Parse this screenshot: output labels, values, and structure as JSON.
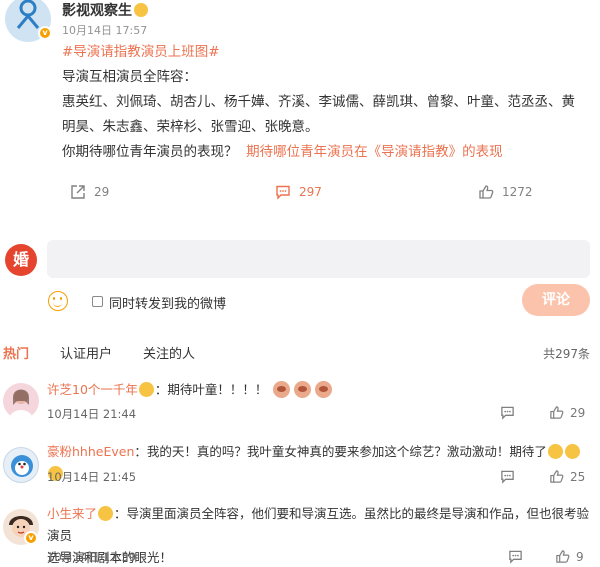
{
  "post": {
    "author": "影视观察生",
    "time": "10月14日 17:57",
    "hashtag": "#导演请指教演员上班图#",
    "line1": "导演互相演员全阵容：",
    "line2": "惠英红、刘佩琦、胡杏儿、杨千嬅、齐溪、李诚儒、薛凯琪、曾黎、叶童、范丞丞、黄",
    "line3": "明昊、朱志鑫、荣梓杉、张雪迎、张晚意。",
    "question": "你期待哪位青年演员的表现？",
    "link": "期待哪位青年演员在《导演请指教》的表现",
    "repost_count": "29",
    "comment_count": "297",
    "like_count": "1272"
  },
  "composer": {
    "avatar_text": "婚",
    "placeholder": "",
    "repost_label": "同时转发到我的微博",
    "submit_label": "评论"
  },
  "tabs": {
    "hot": "热门",
    "verified": "认证用户",
    "following": "关注的人",
    "total": "共297条"
  },
  "comments": [
    {
      "name": "许芝10个一千年",
      "text": "：期待叶童！！！！",
      "time": "10月14日 21:44",
      "likes": "29"
    },
    {
      "name": "豪粉hhheEven",
      "text": "：我的天！真的吗？我叶童女神真的要来参加这个综艺？激动激动！期待了",
      "time": "10月14日 21:45",
      "likes": "25"
    },
    {
      "name": "小生来了",
      "text": "：导演里面演员全阵容，他们要和导演互选。虽然比的最终是导演和作品，但也很考验演员",
      "text2": "选导演和剧本的眼光！",
      "time": "10月14日 17:59",
      "likes": "9"
    }
  ],
  "colors": {
    "accent": "#eb7350",
    "verified_badge": "#f7a000",
    "submit_disabled": "#fbc3ab"
  }
}
